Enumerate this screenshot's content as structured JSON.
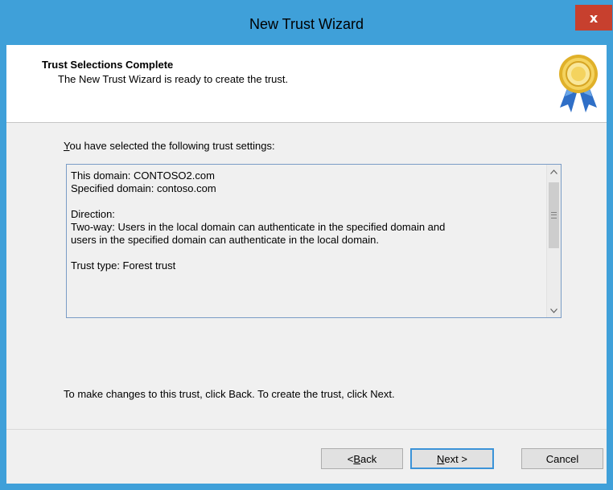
{
  "window": {
    "title": "New Trust Wizard",
    "close_glyph": "x",
    "accent_color": "#3fa0d9",
    "close_color": "#c7402e"
  },
  "header": {
    "title": "Trust Selections Complete",
    "subtitle": "The New Trust Wizard is ready to create the trust.",
    "icon": "award-ribbon-icon"
  },
  "main": {
    "intro_first": "Y",
    "intro_rest": "ou have selected the following trust settings:",
    "summary_text": "This domain: CONTOSO2.com\nSpecified domain: contoso.com\n\nDirection:\nTwo-way: Users in the local domain can authenticate in the specified domain and\nusers in the specified domain can authenticate in the local domain.\n\nTrust type: Forest trust",
    "footer_note": "To make changes to this trust, click Back. To create the trust, click Next."
  },
  "buttons": {
    "back_prefix": "< ",
    "back_key": "B",
    "back_rest": "ack",
    "next_key": "N",
    "next_rest": "ext >",
    "cancel": "Cancel"
  }
}
